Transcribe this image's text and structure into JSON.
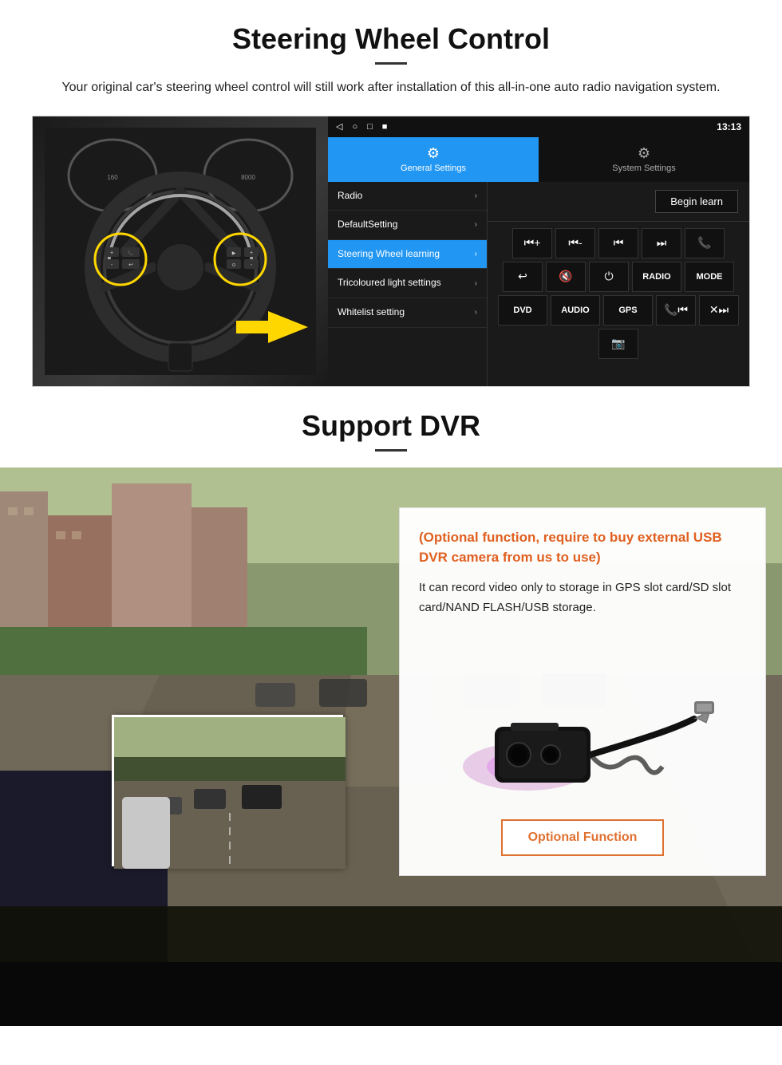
{
  "steering_section": {
    "title": "Steering Wheel Control",
    "subtitle": "Your original car's steering wheel control will still work after installation of this all-in-one auto radio navigation system.",
    "statusbar": {
      "back": "◁",
      "home": "○",
      "square": "□",
      "dot": "■",
      "time": "13:13"
    },
    "tabs": {
      "general": {
        "icon": "⚙",
        "label": "General Settings"
      },
      "system": {
        "icon": "🔧",
        "label": "System Settings"
      }
    },
    "menu_items": [
      {
        "label": "Radio",
        "active": false
      },
      {
        "label": "DefaultSetting",
        "active": false
      },
      {
        "label": "Steering Wheel learning",
        "active": true
      },
      {
        "label": "Tricoloured light settings",
        "active": false
      },
      {
        "label": "Whitelist setting",
        "active": false
      }
    ],
    "begin_learn_label": "Begin learn",
    "control_buttons_row1": [
      "⏮+",
      "⏮-",
      "⏮",
      "⏭",
      "📞"
    ],
    "control_buttons_row2": [
      "↩",
      "🔇",
      "⏻",
      "RADIO",
      "MODE"
    ],
    "control_buttons_row3": [
      "DVD",
      "AUDIO",
      "GPS",
      "📞⏮",
      "✕⏭"
    ],
    "control_buttons_row4": [
      "📷"
    ]
  },
  "dvr_section": {
    "title": "Support DVR",
    "optional_text": "(Optional function, require to buy external USB DVR camera from us to use)",
    "description": "It can record video only to storage in GPS slot card/SD slot card/NAND FLASH/USB storage.",
    "optional_function_label": "Optional Function"
  }
}
